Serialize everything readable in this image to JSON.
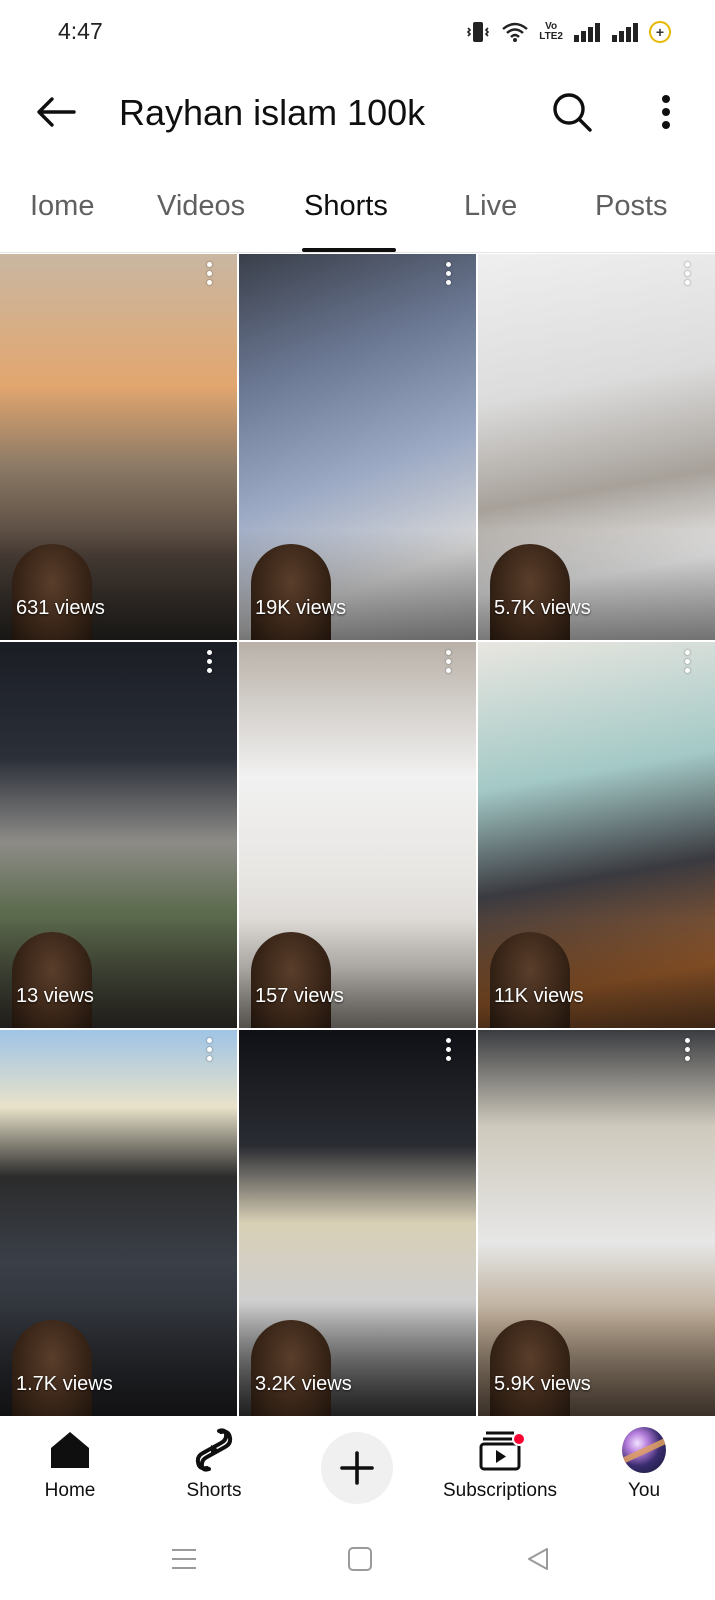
{
  "status_bar": {
    "time": "4:47",
    "icons": [
      "vibrate-icon",
      "wifi-icon",
      "volte-icon",
      "signal-icon",
      "signal-icon",
      "battery-saver-icon"
    ],
    "volte_text": "Vo\nLTE2",
    "battery_symbol": "+"
  },
  "header": {
    "title": "Rayhan islam 100k",
    "icons": [
      "back-arrow-icon",
      "search-icon",
      "more-vert-icon"
    ]
  },
  "tabs": [
    {
      "label": "Home",
      "visible_text": "Iome",
      "active": false
    },
    {
      "label": "Videos",
      "active": false
    },
    {
      "label": "Shorts",
      "active": true
    },
    {
      "label": "Live",
      "active": false
    },
    {
      "label": "Posts",
      "active": false
    }
  ],
  "shorts": [
    {
      "views": "631 views"
    },
    {
      "views": "19K views"
    },
    {
      "views": "5.7K views"
    },
    {
      "views": "13 views"
    },
    {
      "views": "157 views"
    },
    {
      "views": "11K views"
    },
    {
      "views": "1.7K views"
    },
    {
      "views": "3.2K views"
    },
    {
      "views": "5.9K views"
    }
  ],
  "bottom_nav": {
    "items": [
      {
        "label": "Home",
        "icon": "home-icon",
        "active": true
      },
      {
        "label": "Shorts",
        "icon": "shorts-icon",
        "active": false
      },
      {
        "label": "",
        "icon": "create-plus-icon",
        "active": false
      },
      {
        "label": "Subscriptions",
        "icon": "subscriptions-icon",
        "active": false,
        "badge": true
      },
      {
        "label": "You",
        "icon": "avatar",
        "active": false
      }
    ],
    "badge_color": "#ff0033"
  },
  "system_nav": {
    "icons": [
      "menu-lines-icon",
      "square-home-icon",
      "triangle-back-icon"
    ]
  },
  "colors": {
    "text_primary": "#0f0f0f",
    "text_secondary": "#606060",
    "create_button_bg": "#f0f0f0"
  }
}
